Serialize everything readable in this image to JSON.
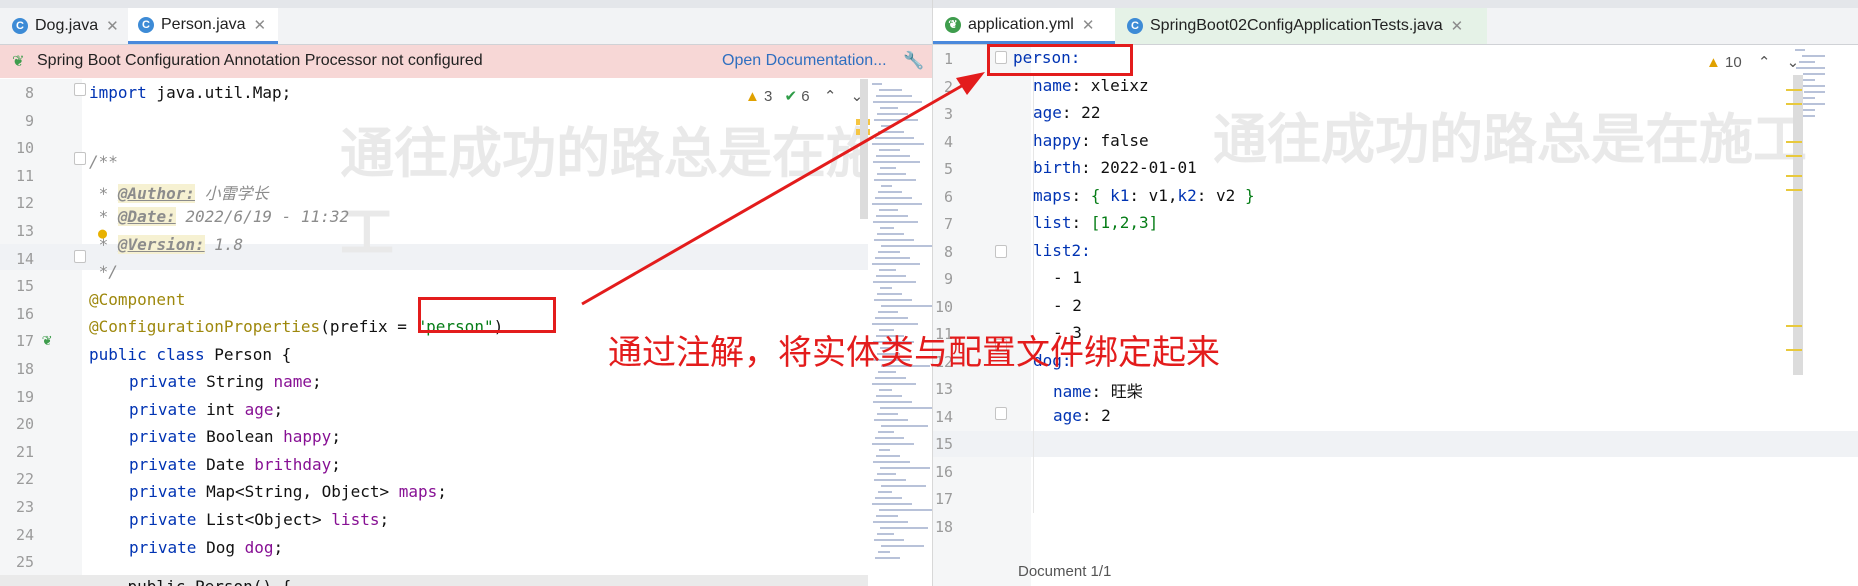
{
  "left_editor": {
    "tabs": [
      {
        "label": "Dog.java",
        "icon": "class-icon"
      },
      {
        "label": "Person.java",
        "icon": "class-icon"
      }
    ],
    "banner": {
      "message": "Spring Boot Configuration Annotation Processor not configured",
      "link": "Open Documentation..."
    },
    "inspections": {
      "warnings": "3",
      "weak_warnings": "6"
    },
    "line_numbers": [
      "8",
      "9",
      "10",
      "11",
      "12",
      "13",
      "14",
      "15",
      "16",
      "17",
      "18",
      "19",
      "20",
      "21",
      "22",
      "23",
      "24",
      "25"
    ],
    "code": {
      "l8_kw": "import",
      "l8_rest": " java.util.Map;",
      "l10": "/**",
      "l11_star": " * ",
      "l11_tag": "@Author:",
      "l11_val": " 小雷学长",
      "l12_star": " * ",
      "l12_tag": "@Date:",
      "l12_val": " 2022/6/19 - 11:32",
      "l13_star": " * ",
      "l13_tag": "@Version:",
      "l13_val": " 1.8",
      "l14": " */",
      "l15": "@Component",
      "l16_ann": "@ConfigurationProperties",
      "l16_mid": "(prefix = ",
      "l16_str": "\"person\"",
      "l16_end": ")",
      "l17_kw": "public class",
      "l17_rest": " Person {",
      "fields": [
        {
          "kw": "private",
          "type": " String ",
          "name": "name",
          "end": ";"
        },
        {
          "kw": "private",
          "type": " int ",
          "name": "age",
          "end": ";"
        },
        {
          "kw": "private",
          "type": " Boolean ",
          "name": "happy",
          "end": ";"
        },
        {
          "kw": "private",
          "type": " Date ",
          "name": "brithday",
          "end": ";"
        },
        {
          "kw": "private",
          "type": " Map<String, Object> ",
          "name": "maps",
          "end": ";"
        },
        {
          "kw": "private",
          "type": " List<Object> ",
          "name": "lists",
          "end": ";"
        },
        {
          "kw": "private",
          "type": " Dog ",
          "name": "dog",
          "end": ";"
        }
      ],
      "l26": "    public Person() {"
    },
    "watermark": "通往成功的路总是在施工"
  },
  "right_editor": {
    "tabs": [
      {
        "label": "application.yml",
        "icon": "yaml-icon"
      },
      {
        "label": "SpringBoot02ConfigApplicationTests.java",
        "icon": "test-class-icon"
      }
    ],
    "inspections": {
      "warnings": "10"
    },
    "line_numbers": [
      "1",
      "2",
      "3",
      "4",
      "5",
      "6",
      "7",
      "8",
      "9",
      "10",
      "11",
      "12",
      "13",
      "14",
      "15",
      "16",
      "17",
      "18"
    ],
    "yaml": {
      "l1_key": "person:",
      "l2_key": "name",
      "l2_val": " xleixz",
      "l3_key": "age",
      "l3_val": " 22",
      "l4_key": "happy",
      "l4_val": " false",
      "l5_key": "birth",
      "l5_val": " 2022-01-01",
      "l6_key": "maps",
      "l6_open": " { ",
      "l6_k1": "k1",
      "l6_v1": ": v1,",
      "l6_k2": "k2",
      "l6_v2": ": v2 ",
      "l6_close": "}",
      "l7_key": "list",
      "l7_val": " [1,2,3]",
      "l8_key": "list2:",
      "l9": "- 1",
      "l10": "- 2",
      "l11": "- 3",
      "l12_key": "dog:",
      "l13_key": "name",
      "l13_val": " 旺柴",
      "l14_key": "age",
      "l14_val": " 2"
    },
    "status": "Document 1/1"
  },
  "annotation": {
    "text": "通过注解，将实体类与配置文件绑定起来",
    "color": "#e31c1c"
  }
}
